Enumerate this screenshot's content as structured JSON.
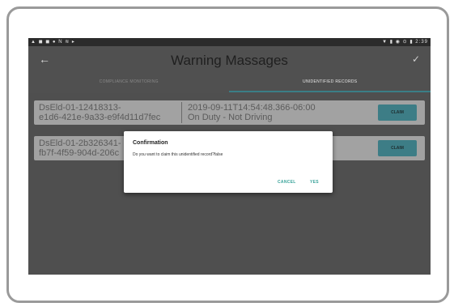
{
  "status_bar": {
    "left_icons": "▲ ◼ ◼ ● N ≋ ▸",
    "right_icons": "▼ ▮ ◉ ⊙ ▮ 2:39"
  },
  "app_bar": {
    "back_icon": "arrow-back-icon",
    "title": "Warning Massages",
    "check_icon": "check-icon"
  },
  "tabs": [
    {
      "label": "COMPLIANCE MONITORING",
      "active": false
    },
    {
      "label": "UNIDENTIFIED RECORDS",
      "active": true
    }
  ],
  "records": [
    {
      "id_line1": "DsEld-01-12418313-",
      "id_line2": "e1d6-421e-9a33-e9f4d11d7fec",
      "detail_line1": "2019-09-11T14:54:48.366-06:00",
      "detail_line2": "On Duty - Not Driving",
      "button": "CLAIM"
    },
    {
      "id_line1": "DsEld-01-2b326341-",
      "id_line2": "fb7f-4f59-904d-206c",
      "detail_line1": "",
      "detail_line2": "",
      "button": "CLAIM"
    }
  ],
  "dialog": {
    "title": "Confirmation",
    "message": "Do you want to claim this unidentified record?false",
    "cancel": "CANCEL",
    "confirm": "YES"
  },
  "colors": {
    "accent": "#3a7e86",
    "dialog_button": "#3aa39a"
  }
}
